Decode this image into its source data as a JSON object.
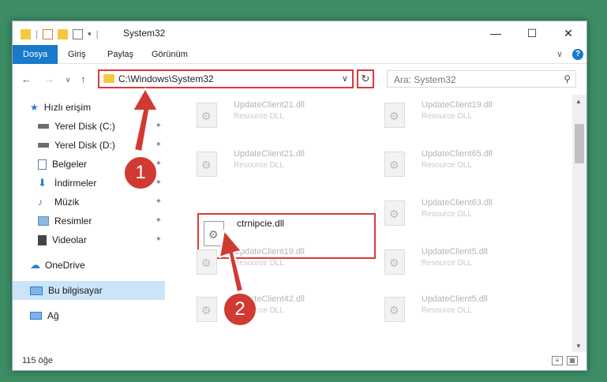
{
  "titlebar": {
    "title": "System32",
    "minimize": "—",
    "maximize": "☐",
    "close": "✕"
  },
  "menu": {
    "file": "Dosya",
    "home": "Giriş",
    "share": "Paylaş",
    "view": "Görünüm",
    "expand": "∨",
    "help": "?"
  },
  "nav": {
    "back": "←",
    "forward": "→",
    "recent": "∨",
    "up": "↑",
    "address": "C:\\Windows\\System32",
    "address_chevron": "∨",
    "refresh": "↻",
    "search_placeholder": "Ara: System32",
    "search_icon": "⚲"
  },
  "sidebar": {
    "items": [
      {
        "label": "Hızlı erişim",
        "icon": "star-icon",
        "color": "#2b7cd3"
      },
      {
        "label": "Yerel Disk (C:)",
        "icon": "drive-icon",
        "color": "#4a4a4a",
        "pinned": true
      },
      {
        "label": "Yerel Disk (D:)",
        "icon": "drive-icon",
        "color": "#4a4a4a",
        "pinned": true
      },
      {
        "label": "Belgeler",
        "icon": "document-icon",
        "color": "#5a7fa8",
        "pinned": true
      },
      {
        "label": "İndirmeler",
        "icon": "download-icon",
        "color": "#2b7cd3",
        "pinned": true
      },
      {
        "label": "Müzik",
        "icon": "music-icon",
        "color": "#2b7cd3",
        "pinned": true
      },
      {
        "label": "Resimler",
        "icon": "pictures-icon",
        "color": "#5a8fc8",
        "pinned": true
      },
      {
        "label": "Videolar",
        "icon": "video-icon",
        "color": "#4a4a4a",
        "pinned": true
      },
      {
        "label": "OneDrive",
        "icon": "cloud-icon",
        "color": "#2b7cd3"
      },
      {
        "label": "Bu bilgisayar",
        "icon": "computer-icon",
        "color": "#2b7cd3",
        "active": true
      },
      {
        "label": "Ağ",
        "icon": "network-icon",
        "color": "#2b7cd3"
      }
    ],
    "pin_glyph": "📌"
  },
  "files": [
    {
      "name": "UpdateClient21.dll",
      "type": "Resource DLL"
    },
    {
      "name": "UpdateClient19.dll",
      "type": "Resource DLL"
    },
    {
      "name": "UpdateClient21.dll",
      "type": "Resource DLL"
    },
    {
      "name": "UpdateClient65.dll",
      "type": "Resource DLL"
    },
    {
      "name": "ctrnipcie.dll",
      "type": "",
      "selected": true
    },
    {
      "name": "UpdateClient63.dll",
      "type": "Resource DLL"
    },
    {
      "name": "UpdateClient19.dll",
      "type": "Resource DLL"
    },
    {
      "name": "UpdateClient5.dll",
      "type": "Resource DLL"
    },
    {
      "name": "UpdateClient42.dll",
      "type": "Resource DLL"
    },
    {
      "name": "UpdateClient5.dll",
      "type": "Resource DLL"
    }
  ],
  "status": {
    "count": "115 öğe",
    "details_view": "≡",
    "large_icons_view": "▦"
  },
  "annotations": {
    "step1": "1",
    "step2": "2",
    "color": "#d13a32"
  },
  "scrollbar": {
    "up": "▲",
    "down": "▼"
  }
}
